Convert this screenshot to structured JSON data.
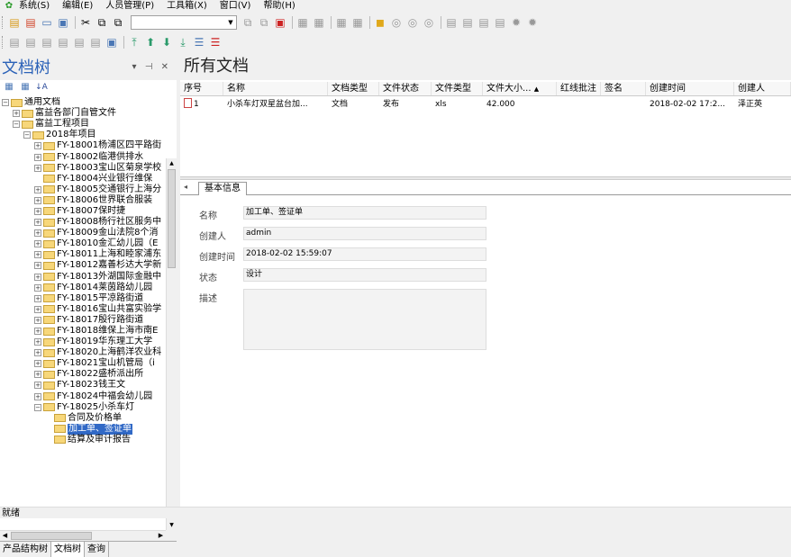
{
  "menu": {
    "items": [
      "系统(S)",
      "编辑(E)",
      "人员管理(P)",
      "工具箱(X)",
      "窗口(V)",
      "帮助(H)"
    ]
  },
  "toolbar1": {
    "icons": [
      "new-doc-icon",
      "delete-doc-icon",
      "window-icon",
      "window-add-icon",
      "cut-icon",
      "copy-icon",
      "paste-icon",
      "cut-lines-icon",
      "pdf-icon",
      "checkin-icon",
      "checkout-icon",
      "lock-icon",
      "unlock-icon",
      "folder-icon",
      "search-icon",
      "settings-icon"
    ],
    "combo_value": ""
  },
  "toolbar2": {
    "icons": [
      "attach-icon",
      "attach2-icon",
      "flag-icon",
      "flag2-icon",
      "report-icon",
      "report2-icon",
      "up-top-icon",
      "up-icon",
      "down-icon",
      "down-bottom-icon",
      "list-icon",
      "list-delete-icon"
    ]
  },
  "left_panel": {
    "title": "文档树",
    "tree": [
      {
        "label": "通用文档",
        "level": 0,
        "expander": "-"
      },
      {
        "label": "富益各部门自管文件",
        "level": 1,
        "expander": "+"
      },
      {
        "label": "富益工程项目",
        "level": 1,
        "expander": "-"
      },
      {
        "label": "2018年项目",
        "level": 2,
        "expander": "-"
      },
      {
        "label": "FY-18001杨浦区四平路街",
        "level": 3,
        "expander": "+"
      },
      {
        "label": "FY-18002临港供排水",
        "level": 3,
        "expander": "+"
      },
      {
        "label": "FY-18003宝山区菊泉学校",
        "level": 3,
        "expander": "+"
      },
      {
        "label": "FY-18004兴业银行维保",
        "level": 3,
        "expander": ""
      },
      {
        "label": "FY-18005交通银行上海分",
        "level": 3,
        "expander": "+"
      },
      {
        "label": "FY-18006世界联合服装",
        "level": 3,
        "expander": "+"
      },
      {
        "label": "FY-18007保时捷",
        "level": 3,
        "expander": "+"
      },
      {
        "label": "FY-18008杨行社区服务中",
        "level": 3,
        "expander": "+"
      },
      {
        "label": "FY-18009金山法院8个消",
        "level": 3,
        "expander": "+"
      },
      {
        "label": "FY-18010金汇幼儿园（E",
        "level": 3,
        "expander": "+"
      },
      {
        "label": "FY-18011上海和睦家浦东",
        "level": 3,
        "expander": "+"
      },
      {
        "label": "FY-18012嘉善杉达大学新",
        "level": 3,
        "expander": "+"
      },
      {
        "label": "FY-18013外湖国际金融中",
        "level": 3,
        "expander": "+"
      },
      {
        "label": "FY-18014莱茵路幼儿园",
        "level": 3,
        "expander": "+"
      },
      {
        "label": "FY-18015平凉路街道",
        "level": 3,
        "expander": "+"
      },
      {
        "label": "FY-18016宝山共富实验学",
        "level": 3,
        "expander": "+"
      },
      {
        "label": "FY-18017殷行路街道",
        "level": 3,
        "expander": "+"
      },
      {
        "label": "FY-18018维保上海市南E",
        "level": 3,
        "expander": "+"
      },
      {
        "label": "FY-18019华东理工大学",
        "level": 3,
        "expander": "+"
      },
      {
        "label": "FY-18020上海鹤洋农业科",
        "level": 3,
        "expander": "+"
      },
      {
        "label": "FY-18021宝山机管局（i",
        "level": 3,
        "expander": "+"
      },
      {
        "label": "FY-18022盛桥派出所",
        "level": 3,
        "expander": "+"
      },
      {
        "label": "FY-18023钱王文",
        "level": 3,
        "expander": "+"
      },
      {
        "label": "FY-18024中福会幼儿园",
        "level": 3,
        "expander": "+"
      },
      {
        "label": "FY-18025小杀车灯",
        "level": 3,
        "expander": "-"
      },
      {
        "label": "合同及价格单",
        "level": 4,
        "expander": ""
      },
      {
        "label": "加工单、签证单",
        "level": 4,
        "expander": "",
        "selected": true
      },
      {
        "label": "结算及审计报告",
        "level": 4,
        "expander": ""
      }
    ],
    "tabs": [
      "产品结构树",
      "文档树",
      "查询"
    ],
    "active_tab": "文档树"
  },
  "right_panel": {
    "title": "所有文档",
    "columns": [
      "序号",
      "名称",
      "文档类型",
      "文件状态",
      "文件类型",
      "文件大小...",
      "红线批注",
      "签名",
      "创建时间",
      "创建人"
    ],
    "rows": [
      [
        "1",
        "小杀车灯双星盆台加...",
        "文档",
        "发布",
        "xls",
        "42.000",
        "",
        "",
        "2018-02-02 17:2...",
        "泽正英"
      ]
    ],
    "detail_tab": "基本信息",
    "detail": {
      "name_label": "名称",
      "name_value": "加工单、签证单",
      "creator_label": "创建人",
      "creator_value": "admin",
      "created_label": "创建时间",
      "created_value": "2018-02-02 15:59:07",
      "state_label": "状态",
      "state_value": "设计",
      "desc_label": "描述",
      "desc_value": ""
    }
  },
  "status_bar": {
    "text": "就绪"
  }
}
